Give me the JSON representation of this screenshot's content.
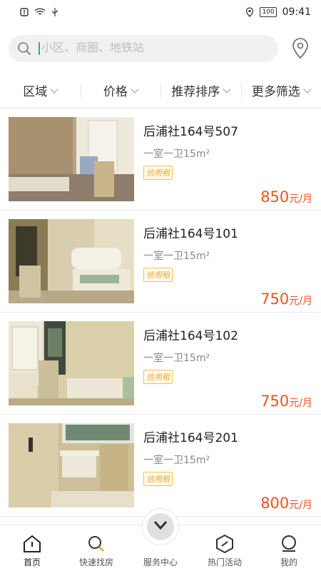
{
  "status": {
    "time": "09:41",
    "battery": "100"
  },
  "search": {
    "placeholder": "小区、商圈、地铁站"
  },
  "filters": [
    "区域",
    "价格",
    "推荐排序",
    "更多筛选"
  ],
  "listings": [
    {
      "title": "后浦社164号507",
      "layout": "一室一卫15m²",
      "tag": "信用租",
      "price": "850",
      "unit": "元/月"
    },
    {
      "title": "后浦社164号101",
      "layout": "一室一卫15m²",
      "tag": "信用租",
      "price": "750",
      "unit": "元/月"
    },
    {
      "title": "后浦社164号102",
      "layout": "一室一卫15m²",
      "tag": "信用租",
      "price": "750",
      "unit": "元/月"
    },
    {
      "title": "后浦社164号201",
      "layout": "一室一卫15m²",
      "tag": "信用租",
      "price": "800",
      "unit": "元/月"
    }
  ],
  "tabs": [
    "首页",
    "快速找房",
    "服务中心",
    "热门活动",
    "我的"
  ],
  "colors": {
    "accent": "#f4511e",
    "tag": "#f0a71b",
    "cursor": "#27b48a"
  }
}
